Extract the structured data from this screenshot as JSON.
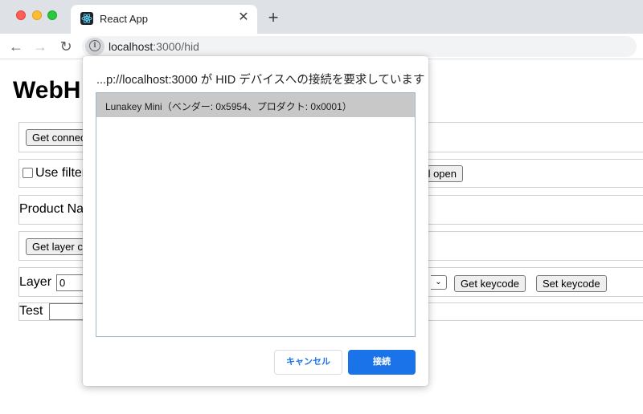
{
  "browser": {
    "tab": {
      "title": "React App",
      "favicon": "react-logo-icon",
      "close_glyph": "✕"
    },
    "new_tab_glyph": "+",
    "nav": {
      "back_glyph": "←",
      "forward_glyph": "→",
      "reload_glyph": "↻"
    },
    "address": {
      "host": "localhost",
      "path": ":3000/hid",
      "info_glyph": "i"
    }
  },
  "page": {
    "title": "WebH",
    "rows": {
      "get_connected_label": "Get connec",
      "use_filter_label": "Use filter",
      "request_open_label": "l open",
      "product_name_label": "Product Na",
      "get_layer_label": "Get layer co",
      "layer_label": "Layer",
      "layer_value": "0",
      "select_arrow": "⌄",
      "get_keycode_label": "Get keycode",
      "set_keycode_label": "Set keycode",
      "test_label": "Test"
    }
  },
  "dialog": {
    "title": "...p://localhost:3000 が HID デバイスへの接続を要求しています",
    "devices": [
      {
        "label": "Lunakey Mini（ベンダー: 0x5954、プロダクト: 0x0001）",
        "selected": true
      }
    ],
    "cancel_label": "キャンセル",
    "connect_label": "接続"
  },
  "colors": {
    "accent": "#1a73e8",
    "selected_item": "#c8c8c8",
    "chrome_bg": "#dee1e6"
  }
}
